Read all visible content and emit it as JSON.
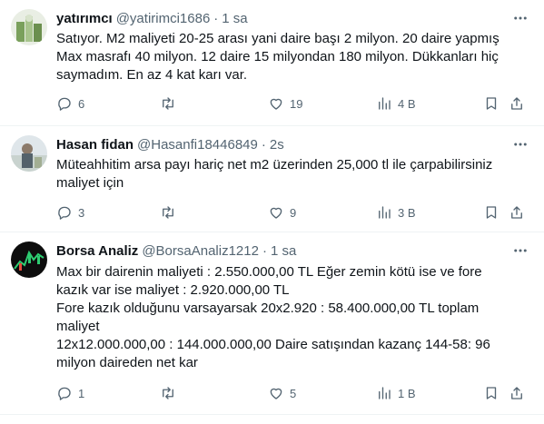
{
  "tweets": [
    {
      "name": "yatırımcı",
      "handle": "@yatirimci1686",
      "separator": "·",
      "time": "1 sa",
      "lines": [
        "Satıyor. M2 maliyeti 20-25 arası yani daire başı 2 milyon. 20 daire yapmış",
        "Max masrafı 40 milyon. 12 daire 15 milyondan 180 milyon. Dükkanları hiç",
        "saymadım. En az 4 kat karı var."
      ],
      "replies": "6",
      "retweets": "",
      "likes": "19",
      "views": "4 B"
    },
    {
      "name": "Hasan fidan",
      "handle": "@Hasanfi18446849",
      "separator": "·",
      "time": "2s",
      "lines": [
        "Müteahhitim arsa payı hariç net m2 üzerinden 25,000 tl ile çarpabilirsiniz",
        "maliyet için"
      ],
      "replies": "3",
      "retweets": "",
      "likes": "9",
      "views": "3 B"
    },
    {
      "name": "Borsa Analiz",
      "handle": "@BorsaAnaliz1212",
      "separator": "·",
      "time": "1 sa",
      "lines": [
        "Max bir dairenin maliyeti : 2.550.000,00 TL Eğer zemin kötü ise ve fore",
        "kazık var ise maliyet : 2.920.000,00 TL",
        "Fore kazık olduğunu varsayarsak 20x2.920 : 58.400.000,00 TL toplam",
        "maliyet",
        "12x12.000.000,00 : 144.000.000,00 Daire satışından kazanç 144-58: 96",
        "milyon daireden net kar"
      ],
      "replies": "1",
      "retweets": "",
      "likes": "5",
      "views": "1 B"
    }
  ],
  "icons": {
    "more": "more-horizontal-icon",
    "reply": "reply-icon",
    "retweet": "retweet-icon",
    "like": "heart-icon",
    "views": "views-chart-icon",
    "bookmark": "bookmark-icon",
    "share": "share-icon"
  },
  "colors": {
    "text": "#0f1419",
    "secondary": "#536471",
    "divider": "#eff3f4"
  }
}
